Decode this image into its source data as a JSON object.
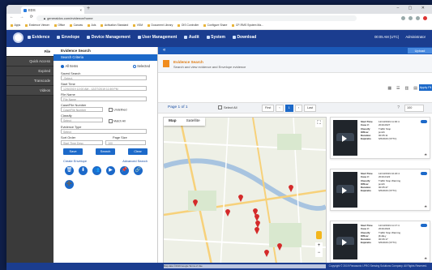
{
  "browser": {
    "tab_title": "EDS",
    "url": "▲ generaldcs.com/evidence/home",
    "window_controls": "– ▢ ✕",
    "bookmarks": [
      "Apps",
      "Evidence Viewer",
      "Office",
      "Canvas",
      "Ads",
      "Activation Standard",
      "VSM",
      "Document Library",
      "OIS Controller",
      "Configure Share",
      "CP-RMS System Ma..."
    ]
  },
  "app": {
    "menu": [
      "Evidence",
      "Envelope",
      "Device Management",
      "User Management",
      "Audit",
      "System",
      "Download"
    ],
    "user_info": "00:05 AM (UTC)",
    "admin_label": "Administrator"
  },
  "left_nav": [
    "File",
    "Quick Access",
    "Expired",
    "Transcode",
    "Videos"
  ],
  "search_panel": {
    "title": "Evidence Search",
    "criteria_label": "Search Criteria",
    "radio_all": "All Items",
    "radio_selected": "Selected",
    "saved_search_label": "Saved Search",
    "saved_search_value": "-Select-",
    "start_time_label": "Start Time",
    "start_time_value": "12/5/2019 12:00 AM - 12/27/2019 11:59 PM",
    "file_name_label": "File Name",
    "file_name_placeholder": "File Name",
    "case_file_label": "Case/File Number",
    "case_file_placeholder": "Case/File Number",
    "undefined_label": "Undefined",
    "classify_label": "Classify",
    "classify_value": "Select",
    "match_all_label": "Match All",
    "evidence_type_label": "Evidence Type",
    "evidence_type_value": "Select",
    "sort_order_label": "Sort Order",
    "sort_order_value": "Start Time Desc",
    "page_size_label": "Page Size",
    "page_size_value": "100",
    "btn_save": "Save",
    "btn_search": "Search",
    "btn_clear": "Clear",
    "link_create": "Create Envelope",
    "link_advanced": "Advanced Search",
    "action_icons": [
      "🗑",
      "⬇",
      "👥",
      "▶",
      "📌",
      "🔗",
      "➕"
    ]
  },
  "main": {
    "upload_label": "Upload",
    "bread_title": "Evidence Search",
    "bread_desc": "Search and view evidence and Envelope evidence",
    "apply_label": "Apply Fil",
    "view_icons": [
      "▦",
      "☰",
      "▥",
      "▤"
    ],
    "page_label": "Page 1 of 1",
    "select_all": "Select All",
    "pager": [
      "First",
      "‹",
      "1",
      "›",
      "Last"
    ],
    "page_size_sel": "100",
    "help": "?",
    "map_tab_map": "Map",
    "map_tab_sat": "Satellite",
    "map_footer": "Map data ©2019 Google   Terms of Use"
  },
  "cards": [
    {
      "start_time": "12/13/2019 11:30:4",
      "case_no": "2019-0027",
      "classify": "Traffic Stop",
      "officer": "jsmith",
      "duration": "00:05:11",
      "expiration": "6/6/2020",
      "tag": "(STTC)"
    },
    {
      "start_time": "12/13/2019 10:20:4",
      "case_no": "2019-0122",
      "classify": "Traffic Stop Warning",
      "officer": "jsmith",
      "duration": "00:05:47",
      "expiration": "6/6/2020",
      "tag": "(STTC)"
    },
    {
      "start_time": "12/13/2019 11:17:4",
      "case_no": "2019-0024",
      "classify": "Traffic Stop Warning",
      "officer": "jfindley",
      "duration": "00:06:17",
      "expiration": "6/6/2020",
      "tag": "(STTC)"
    }
  ],
  "card_labels": {
    "start": "Start Time",
    "case": "Case #:",
    "classify": "Classify",
    "officer": "Officer",
    "duration": "Duration",
    "expiration": "Expiratio"
  },
  "footer": "Copyright © 2019 Panasonic i-PRO Sensing Solutions Company. All Rights Reserved."
}
